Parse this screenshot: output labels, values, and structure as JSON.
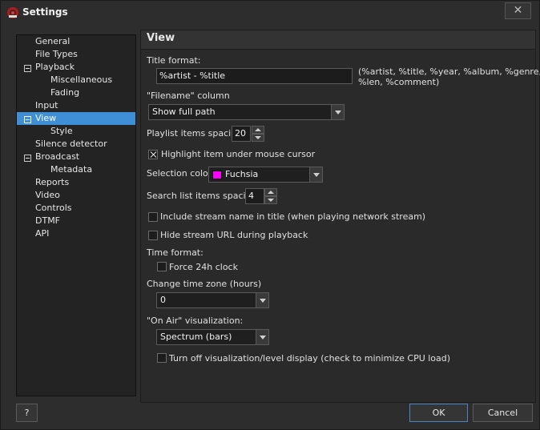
{
  "window": {
    "title": "Settings",
    "close_glyph": "✕",
    "icon": "app-logo-icon",
    "accent_color": "#3f8fd6"
  },
  "tree": {
    "items": [
      {
        "label": "General"
      },
      {
        "label": "File Types"
      },
      {
        "label": "Playback",
        "expanded": true
      },
      {
        "label": "Miscellaneous"
      },
      {
        "label": "Fading"
      },
      {
        "label": "Input"
      },
      {
        "label": "View",
        "expanded": true,
        "selected": true
      },
      {
        "label": "Style"
      },
      {
        "label": "Silence detector"
      },
      {
        "label": "Broadcast",
        "expanded": true
      },
      {
        "label": "Metadata"
      },
      {
        "label": "Reports"
      },
      {
        "label": "Video"
      },
      {
        "label": "Controls"
      },
      {
        "label": "DTMF"
      },
      {
        "label": "API"
      }
    ]
  },
  "view": {
    "header": "View",
    "title_format": {
      "label": "Title format:",
      "value": "%artist - %title",
      "hint_line1": "(%artist, %title, %year, %album, %genre,",
      "hint_line2": "%len, %comment)"
    },
    "filename_column": {
      "label": "\"Filename\" column",
      "value": "Show full path"
    },
    "playlist_spacing": {
      "label": "Playlist items spacing",
      "value": "20"
    },
    "highlight_item": {
      "label": "Highlight item under mouse cursor",
      "checked": true
    },
    "selection_color": {
      "label": "Selection color",
      "value": "Fuchsia",
      "color": "#ff00ff"
    },
    "search_spacing": {
      "label": "Search list items spacing",
      "value": "4"
    },
    "include_stream_name": {
      "label": "Include stream name in title (when playing network stream)",
      "checked": false
    },
    "hide_stream_url": {
      "label": "Hide stream URL during playback",
      "checked": false
    },
    "time_format": {
      "label": "Time format:",
      "force_24h_label": "Force 24h clock",
      "force_24h_checked": false
    },
    "time_zone": {
      "label": "Change time zone (hours)",
      "value": "0"
    },
    "on_air": {
      "label": "\"On Air\" visualization:",
      "value": "Spectrum (bars)",
      "turn_off_label": "Turn off visualization/level display (check to minimize CPU load)",
      "turn_off_checked": false
    }
  },
  "buttons": {
    "help": "?",
    "ok": "OK",
    "cancel": "Cancel"
  }
}
